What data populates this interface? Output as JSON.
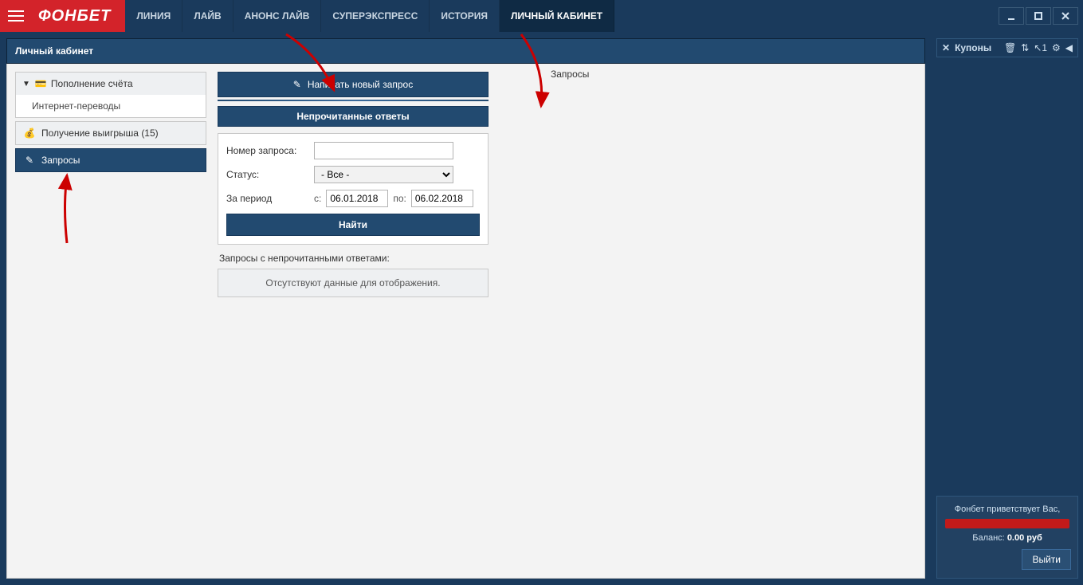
{
  "brand": "ФОНБЕТ",
  "nav": {
    "items": [
      "ЛИНИЯ",
      "ЛАЙВ",
      "АНОНС ЛАЙВ",
      "СУПЕРЭКСПРЕСС",
      "ИСТОРИЯ",
      "ЛИЧНЫЙ КАБИНЕТ"
    ],
    "active_index": 5
  },
  "panel": {
    "title": "Личный кабинет"
  },
  "sidemenu": {
    "group_deposit": {
      "title": "Пополнение счёта",
      "sub": "Интернет-переводы"
    },
    "item_payout": "Получение выигрыша (15)",
    "item_requests": "Запросы"
  },
  "center": {
    "new_request_btn": "Написать новый запрос",
    "unread_title": "Непрочитанные ответы",
    "filter": {
      "label_number": "Номер запроса:",
      "number_value": "",
      "label_status": "Статус:",
      "status_value": "- Все -",
      "label_period": "За период",
      "from_prefix": "с:",
      "from_value": "06.01.2018",
      "to_prefix": "по:",
      "to_value": "06.02.2018",
      "find_btn": "Найти"
    },
    "unread_note": "Запросы с непрочитанными ответами:",
    "empty_msg": "Отсутствуют данные для отображения."
  },
  "requests_heading": "Запросы",
  "rightbar": {
    "coupons_label": "Купоны",
    "count_label": "1",
    "welcome": "Фонбет приветствует Вас,",
    "balance_label": "Баланс:",
    "balance_value": "0.00 руб",
    "logout": "Выйти"
  }
}
